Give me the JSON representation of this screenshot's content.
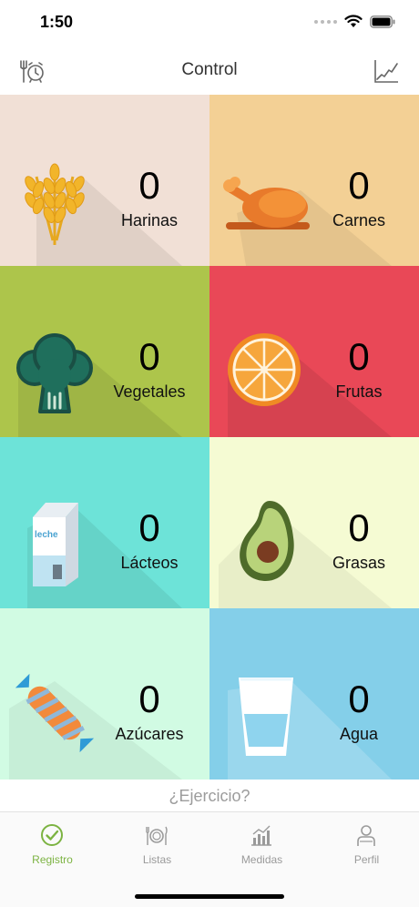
{
  "status": {
    "time": "1:50"
  },
  "nav": {
    "title": "Control",
    "left_icon": "meal-clock-icon",
    "right_icon": "chart-icon"
  },
  "categories": [
    {
      "label": "Harinas",
      "count": "0",
      "bg": "#f1e0d6",
      "icon": "wheat-icon"
    },
    {
      "label": "Carnes",
      "count": "0",
      "bg": "#f3d095",
      "icon": "roast-chicken-icon"
    },
    {
      "label": "Vegetales",
      "count": "0",
      "bg": "#adc54b",
      "icon": "broccoli-icon"
    },
    {
      "label": "Frutas",
      "count": "0",
      "bg": "#e94857",
      "icon": "orange-slice-icon"
    },
    {
      "label": "Lácteos",
      "count": "0",
      "bg": "#6de3d8",
      "icon": "milk-carton-icon"
    },
    {
      "label": "Grasas",
      "count": "0",
      "bg": "#f5fbd3",
      "icon": "avocado-icon"
    },
    {
      "label": "Azúcares",
      "count": "0",
      "bg": "#d1fbe3",
      "icon": "candy-icon"
    },
    {
      "label": "Agua",
      "count": "0",
      "bg": "#84cfe9",
      "icon": "water-glass-icon"
    }
  ],
  "milk_text": "leche",
  "exercise": {
    "label": "¿Ejercicio?"
  },
  "tabs": [
    {
      "label": "Registro",
      "icon": "check-circle-icon",
      "active": true
    },
    {
      "label": "Listas",
      "icon": "plate-icon",
      "active": false
    },
    {
      "label": "Medidas",
      "icon": "bar-chart-icon",
      "active": false
    },
    {
      "label": "Perfil",
      "icon": "person-icon",
      "active": false
    }
  ],
  "colors": {
    "accent": "#7cb342"
  }
}
